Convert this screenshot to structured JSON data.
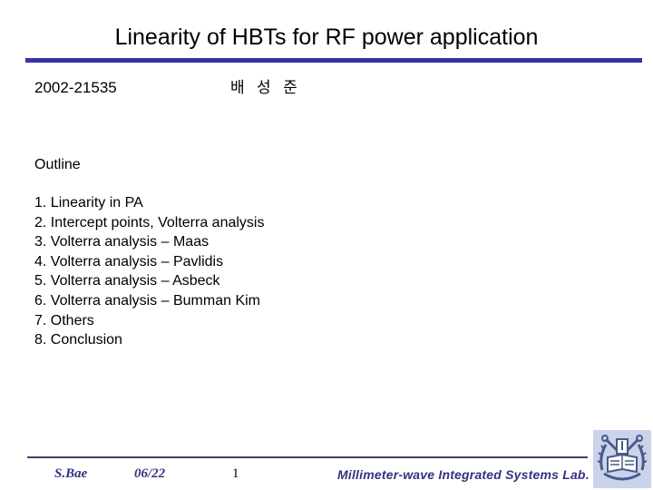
{
  "slide": {
    "title": "Linearity of HBTs for RF power application",
    "student_id": "2002-21535",
    "student_name": "배 성 준",
    "outline": {
      "heading": "Outline",
      "items": [
        "1. Linearity in PA",
        "2. Intercept points, Volterra analysis",
        "3. Volterra analysis – Maas",
        "4. Volterra analysis – Pavlidis",
        "5. Volterra analysis – Asbeck",
        "6. Volterra analysis – Bumman Kim",
        "7. Others",
        "8. Conclusion"
      ]
    }
  },
  "footer": {
    "author": "S.Bae",
    "date": "06/22",
    "page_number": "1",
    "lab_name": "Millimeter-wave Integrated Systems Lab.",
    "logo_icon": "university-emblem-icon"
  },
  "colors": {
    "title_rule": "#3333a8",
    "footer_rule": "#3d3d78",
    "footer_text": "#333380",
    "logo_background": "#c9d3ea"
  }
}
